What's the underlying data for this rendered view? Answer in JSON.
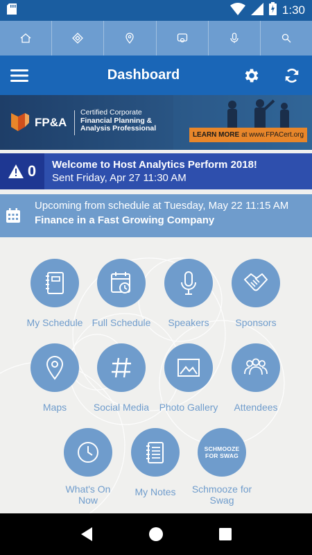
{
  "status_bar": {
    "time": "1:30",
    "icons": [
      "sd-card-icon",
      "wifi-icon",
      "signal-icon",
      "battery-charging-icon"
    ]
  },
  "toolbar": {
    "items": [
      "home-icon",
      "ticket-icon",
      "map-pin-icon",
      "chat-icon",
      "microphone-icon",
      "search-icon"
    ]
  },
  "header": {
    "title": "Dashboard",
    "menu_icon": "hamburger-menu-icon",
    "settings_icon": "gear-icon",
    "refresh_icon": "refresh-icon"
  },
  "banner": {
    "logo_text": "FP&A",
    "cert_line1": "Certified Corporate",
    "cert_line2": "Financial Planning &",
    "cert_line3": "Analysis Professional",
    "learn_more": "LEARN MORE",
    "learn_more_suffix": "at www.FPACert.org",
    "colors": {
      "accent": "#e8862a",
      "background": "#27507e"
    }
  },
  "alert": {
    "count": "0",
    "title": "Welcome to Host Analytics Perform 2018!",
    "subtitle": "Sent Friday, Apr 27 11:30 AM",
    "icon": "warning-icon"
  },
  "schedule": {
    "line1": "Upcoming from schedule at Tuesday, May 22 11:15 AM",
    "line2": "Finance in a Fast Growing Company",
    "icon": "calendar-icon"
  },
  "tiles": [
    {
      "label": "My Schedule",
      "icon": "notebook-icon"
    },
    {
      "label": "Full Schedule",
      "icon": "calendar-clock-icon"
    },
    {
      "label": "Speakers",
      "icon": "microphone-icon"
    },
    {
      "label": "Sponsors",
      "icon": "handshake-icon"
    },
    {
      "label": "Maps",
      "icon": "map-pin-icon"
    },
    {
      "label": "Social Media",
      "icon": "hashtag-icon"
    },
    {
      "label": "Photo Gallery",
      "icon": "image-icon"
    },
    {
      "label": "Attendees",
      "icon": "people-icon"
    },
    {
      "label_line1": "What's On",
      "label_line2": "Now",
      "icon": "clock-icon"
    },
    {
      "label": "My Notes",
      "icon": "notes-icon"
    },
    {
      "label_line1": "Schmooze for",
      "label_line2": "Swag",
      "icon": "schmooze-logo",
      "badge_line1": "SCHMOOZE",
      "badge_line2": "FOR SWAG"
    }
  ],
  "colors": {
    "primary": "#1a66b7",
    "tile": "#6f9ccc",
    "alert": "#2e4fad"
  },
  "navbar": {
    "items": [
      "back-icon",
      "home-icon",
      "recents-icon"
    ]
  }
}
